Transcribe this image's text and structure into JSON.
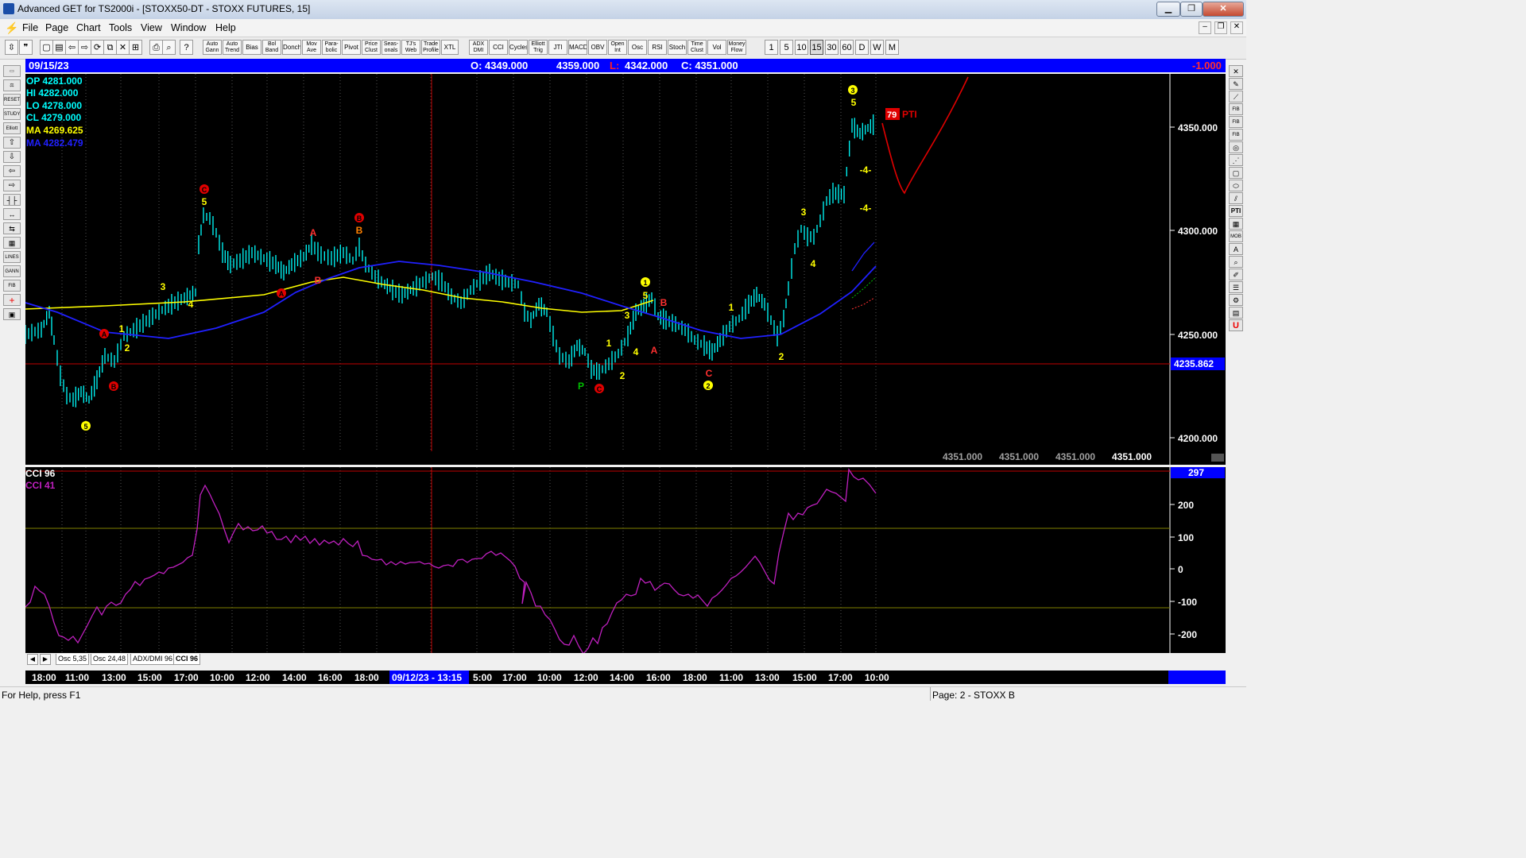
{
  "window": {
    "title": "Advanced GET for TS2000i - [STOXX50-DT - STOXX FUTURES, 15]",
    "min": "▁",
    "restore": "❐",
    "close": "✕",
    "doc_min": "–",
    "doc_restore": "❐",
    "doc_close": "✕"
  },
  "menu": [
    "File",
    "Page",
    "Chart",
    "Tools",
    "View",
    "Window",
    "Help"
  ],
  "toolbar_studies": [
    {
      "line1": "Auto",
      "line2": "Gann"
    },
    {
      "line1": "Auto",
      "line2": "Trend"
    },
    {
      "line1": "Bias",
      "line2": ""
    },
    {
      "line1": "Bol",
      "line2": "Band"
    },
    {
      "line1": "Donch",
      "line2": ""
    },
    {
      "line1": "Mov",
      "line2": "Ave"
    },
    {
      "line1": "Para-",
      "line2": "bolic"
    },
    {
      "line1": "Pivot",
      "line2": ""
    },
    {
      "line1": "Price",
      "line2": "Clust"
    },
    {
      "line1": "Seas-",
      "line2": "onals"
    },
    {
      "line1": "TJ's",
      "line2": "Web"
    },
    {
      "line1": "Trade",
      "line2": "Profile"
    },
    {
      "line1": "XTL",
      "line2": ""
    },
    {
      "line1": "ADX",
      "line2": "DMI"
    },
    {
      "line1": "CCI",
      "line2": ""
    },
    {
      "line1": "Cycles",
      "line2": ""
    },
    {
      "line1": "Elliott",
      "line2": "Trig"
    },
    {
      "line1": "JTI",
      "line2": ""
    },
    {
      "line1": "MACD",
      "line2": ""
    },
    {
      "line1": "OBV",
      "line2": ""
    },
    {
      "line1": "Open",
      "line2": "Int"
    },
    {
      "line1": "Osc",
      "line2": ""
    },
    {
      "line1": "RSI",
      "line2": ""
    },
    {
      "line1": "Stoch",
      "line2": ""
    },
    {
      "line1": "Time",
      "line2": "Clust"
    },
    {
      "line1": "Vol",
      "line2": ""
    },
    {
      "line1": "Money",
      "line2": "Flow"
    }
  ],
  "timeframes": [
    "1",
    "5",
    "10",
    "15",
    "30",
    "60",
    "D",
    "W",
    "M"
  ],
  "left_tools": [
    "RESET",
    "STUDY",
    "Elliott",
    "LINES",
    "GANN",
    "FIB"
  ],
  "right_tools": [
    "FIB RET",
    "FIB EXT",
    "FIB TIME",
    "PTI",
    "MOB"
  ],
  "header": {
    "date": "09/15/23",
    "open": "O: 4349.000",
    "high": "4359.000",
    "low_label": "L:",
    "low": "4342.000",
    "close": "C: 4351.000",
    "change": "-1.000"
  },
  "legend": {
    "op": "OP  4281.000",
    "hi": "HI   4282.000",
    "lo": "LO  4278.000",
    "cl": "CL  4279.000",
    "ma1": "MA  4269.625",
    "ma2": "MA  4282.479"
  },
  "price_axis": [
    "4350.000",
    "4300.000",
    "4250.000",
    "4200.000"
  ],
  "crosshair_price": "4235.862",
  "bottom_values": [
    "4351.000",
    "4351.000",
    "4351.000",
    "4351.000"
  ],
  "pti_value": "79",
  "pti_label": "PTI",
  "wave_labels": {
    "c_left": "C",
    "five_left": "5",
    "c_mid": "B",
    "b_mid": "B",
    "a1": "A",
    "b1": "B",
    "a2": "A",
    "b2": "B",
    "three_a": "3",
    "four_a": "4",
    "one_a": "1",
    "two_a": "2",
    "five_bottom": "5",
    "one_b": "1",
    "five_b": "5",
    "three_b": "3",
    "b3": "B",
    "a3": "A",
    "one_c": "1",
    "four_c": "4",
    "two_c": "2",
    "p_green": "P",
    "c_red": "C",
    "c_small": "C",
    "two_circle": "2",
    "one_d": "1",
    "two_d": "2",
    "three_d": "3",
    "four_d": "4",
    "three_top": "3",
    "five_top": "5",
    "minus4_a": "-4-",
    "minus4_b": "-4-"
  },
  "cci": {
    "label1": "CCI 96",
    "label2": "CCI  41",
    "value": "297",
    "axis": [
      "200",
      "100",
      "0",
      "-100",
      "-200"
    ]
  },
  "tabs": [
    "Osc 5,35",
    "Osc 24,48",
    "ADX/DMI 96",
    "CCI 96"
  ],
  "time_axis": [
    "18:00",
    "11:00",
    "13:00",
    "15:00",
    "17:00",
    "10:00",
    "12:00",
    "14:00",
    "16:00",
    "18:00",
    "09/12/23 - 13:15",
    "5:00",
    "17:00",
    "10:00",
    "12:00",
    "14:00",
    "16:00",
    "18:00",
    "11:00",
    "13:00",
    "15:00",
    "17:00",
    "10:00"
  ],
  "status": {
    "help": "For Help, press F1",
    "page": "Page: 2 - STOXX B"
  },
  "colors": {
    "chart_bg": "#000000",
    "bars": "#00ffff",
    "ma_yellow": "#ffff00",
    "ma_blue": "#1a1aff",
    "cci_line": "#c020c0",
    "header_blue": "#0000ff",
    "red": "#ff0000"
  }
}
